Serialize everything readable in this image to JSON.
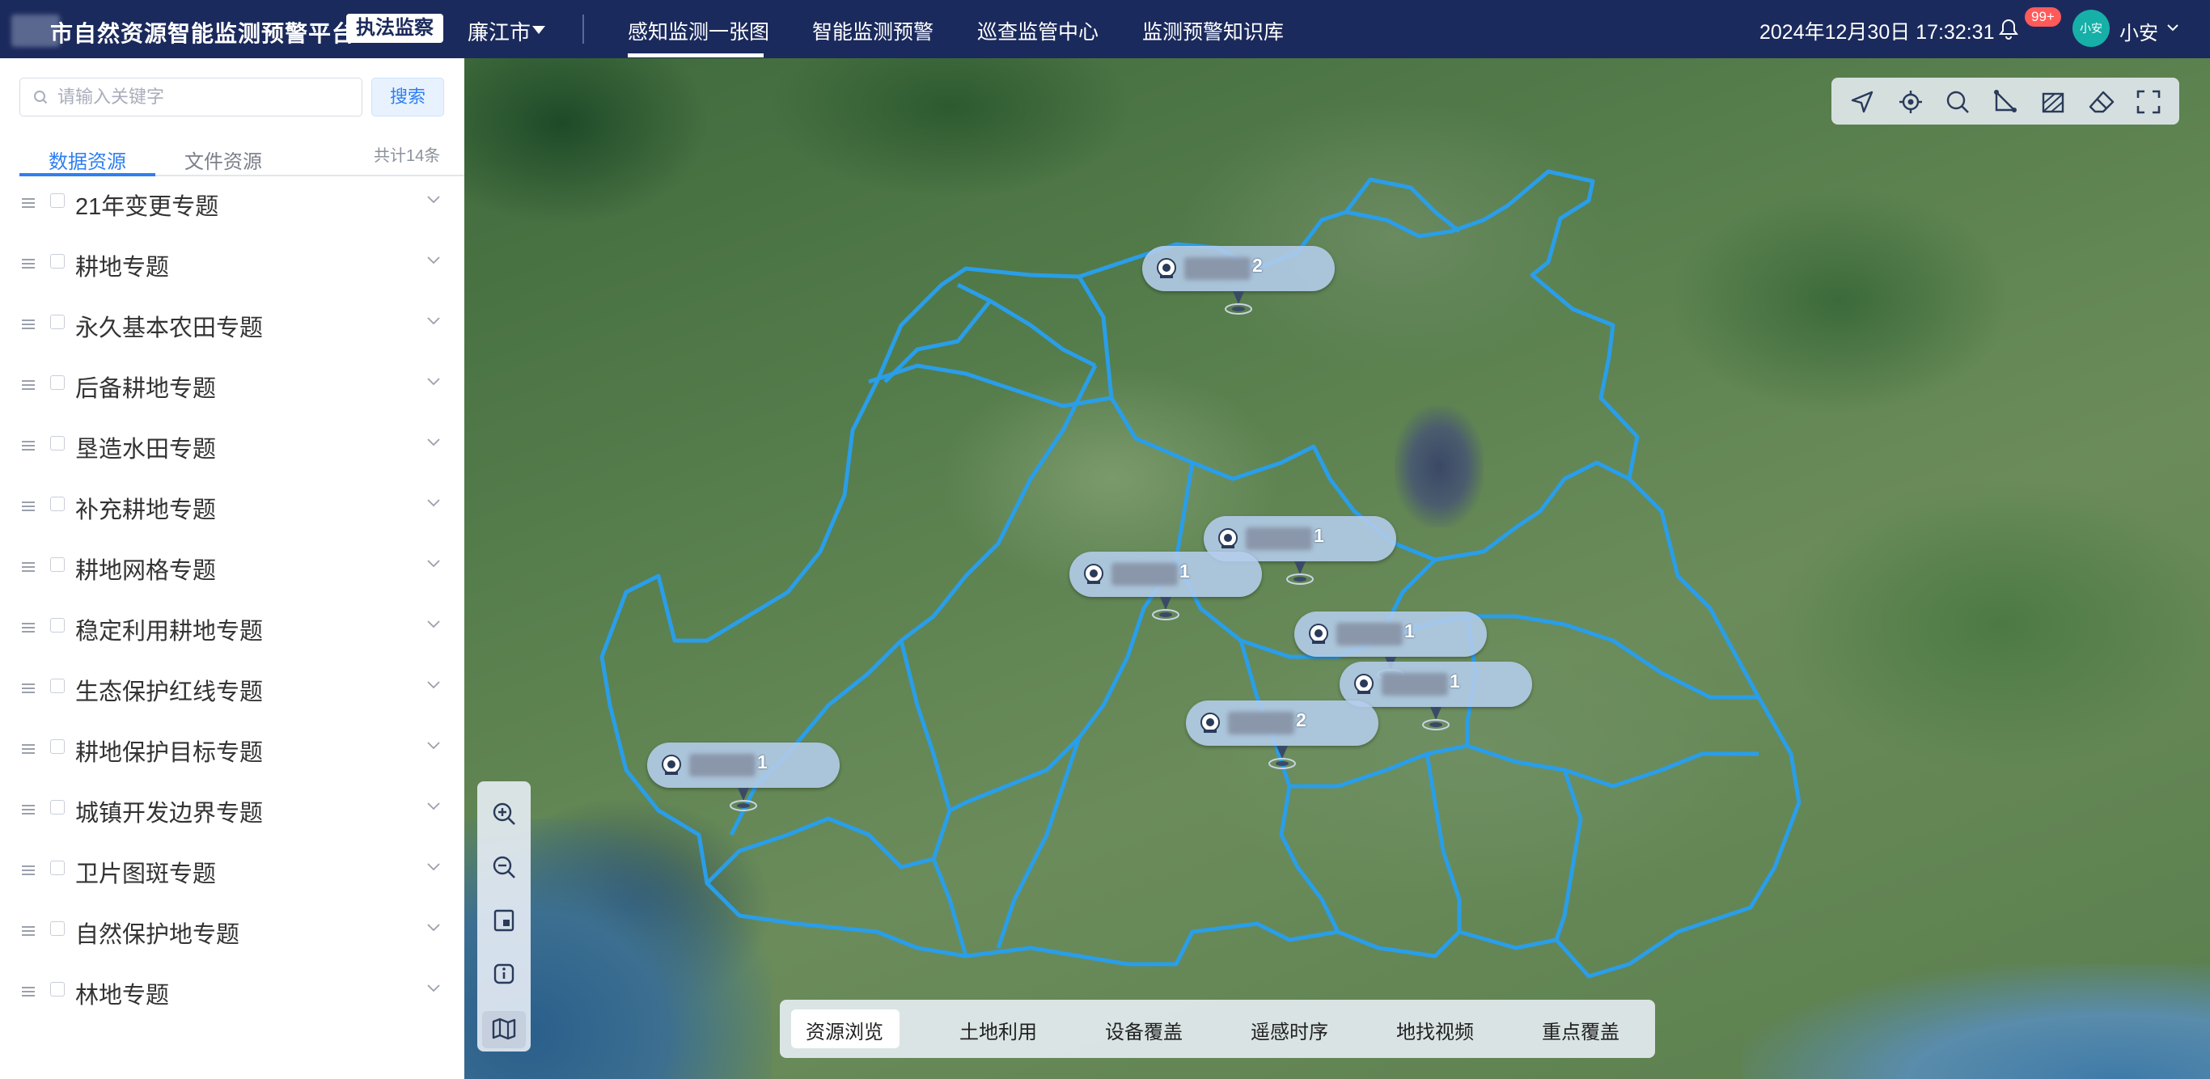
{
  "header": {
    "app_title": "市自然资源智能监测预警平台",
    "role_badge": "执法监察",
    "city": "廉江市",
    "nav": [
      "感知监测一张图",
      "智能监测预警",
      "巡查监管中心",
      "监测预警知识库"
    ],
    "active_nav": "感知监测一张图",
    "datetime": "2024年12月30日 17:32:31",
    "notifications": "99+",
    "avatar_text": "小安",
    "username": "小安"
  },
  "sidebar": {
    "search_placeholder": "请输入关键字",
    "search_button": "搜索",
    "tabs": [
      "数据资源",
      "文件资源"
    ],
    "active_tab": "数据资源",
    "total": "共计14条",
    "layers": [
      "21年变更专题",
      "耕地专题",
      "永久基本农田专题",
      "后备耕地专题",
      "垦造水田专题",
      "补充耕地专题",
      "耕地网格专题",
      "稳定利用耕地专题",
      "生态保护红线专题",
      "耕地保护目标专题",
      "城镇开发边界专题",
      "卫片图斑专题",
      "自然保护地专题",
      "林地专题"
    ]
  },
  "map": {
    "markers": [
      {
        "count": "2"
      },
      {
        "count": "1"
      },
      {
        "count": "1"
      },
      {
        "count": "1"
      },
      {
        "count": "1"
      },
      {
        "count": "2"
      },
      {
        "count": "1"
      }
    ],
    "tools": [
      "navigate-icon",
      "locate-icon",
      "search-icon",
      "measure-distance-icon",
      "measure-area-icon",
      "eraser-icon",
      "fullscreen-icon"
    ],
    "zoom_tools": [
      "zoom-in-icon",
      "zoom-out-icon",
      "basemap-icon",
      "info-icon",
      "map-icon"
    ],
    "bottom_tabs": [
      "资源浏览",
      "土地利用",
      "设备覆盖",
      "遥感时序",
      "地找视频",
      "重点覆盖"
    ],
    "active_bottom_tab": "资源浏览"
  },
  "colors": {
    "header_bg": "#1b2a5c",
    "accent": "#2f7ff0",
    "boundary": "#2a9ee8",
    "badge": "#ff5a5a"
  }
}
